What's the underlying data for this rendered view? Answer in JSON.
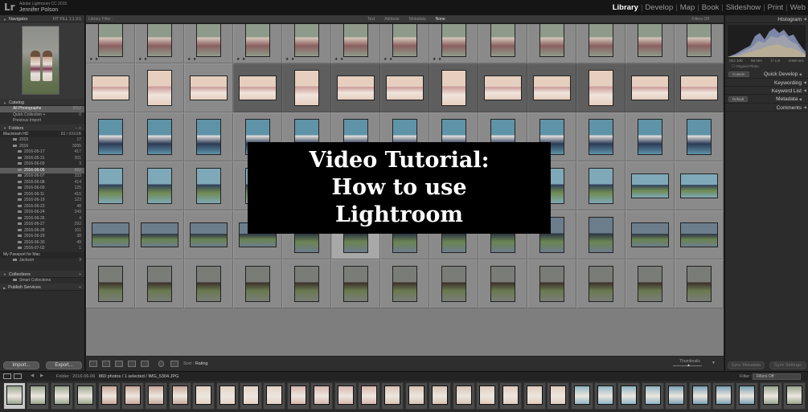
{
  "app": {
    "logo": "Lr",
    "name": "Adobe Lightroom CC 2015",
    "user": "Jennifer Polson"
  },
  "modules": [
    "Library",
    "Develop",
    "Map",
    "Book",
    "Slideshow",
    "Print",
    "Web"
  ],
  "active_module": "Library",
  "left_panel": {
    "navigator": {
      "title": "Navigator",
      "zoom_options": "FIT  FILL  1:1  3:1"
    },
    "catalog": {
      "title": "Catalog",
      "items": [
        {
          "label": "All Photographs",
          "count": "3112"
        },
        {
          "label": "Quick Collection +",
          "count": "0"
        },
        {
          "label": "Previous Import",
          "count": ""
        }
      ]
    },
    "folders": {
      "title": "Folders",
      "volume": {
        "label": "Macintosh HD",
        "count": "83 / 931GB"
      },
      "items": [
        {
          "label": "2015",
          "count": "17"
        },
        {
          "label": "2016",
          "count": "3095"
        },
        {
          "label": "2016-05-17",
          "count": "417"
        },
        {
          "label": "2016-05-31",
          "count": "201"
        },
        {
          "label": "2016-06-03",
          "count": "3"
        },
        {
          "label": "2016-06-06",
          "count": "860",
          "selected": true
        },
        {
          "label": "2016-06-07",
          "count": "333"
        },
        {
          "label": "2016-06-08",
          "count": "414"
        },
        {
          "label": "2016-06-09",
          "count": "125"
        },
        {
          "label": "2016-06-11",
          "count": "415"
        },
        {
          "label": "2016-06-19",
          "count": "123"
        },
        {
          "label": "2016-06-23",
          "count": "48"
        },
        {
          "label": "2016-06-24",
          "count": "249"
        },
        {
          "label": "2016-06-26",
          "count": "4"
        },
        {
          "label": "2016-06-27",
          "count": "292"
        },
        {
          "label": "2016-06-28",
          "count": "101"
        },
        {
          "label": "2016-06-29",
          "count": "38"
        },
        {
          "label": "2016-06-30",
          "count": "49"
        },
        {
          "label": "2016-07-02",
          "count": "1"
        }
      ],
      "volume2": {
        "label": "My Passport for Mac",
        "count": ""
      },
      "volume2_item": {
        "label": "Jackson",
        "count": "3"
      }
    },
    "collections": {
      "title": "Collections",
      "items": [
        {
          "label": "Smart Collections",
          "count": ""
        }
      ]
    },
    "publish": {
      "title": "Publish Services"
    },
    "import_label": "Import...",
    "export_label": "Export..."
  },
  "filter_bar": {
    "label": "Library Filter :",
    "options": [
      "Text",
      "Attribute",
      "Metadata",
      "None"
    ],
    "active": "None",
    "filters_off": "Filters Off"
  },
  "grid": {
    "rows": 6,
    "cols": 13,
    "star_text": "★ ★"
  },
  "overlay": {
    "line1": "Video Tutorial:",
    "line2": "How to use",
    "line3": "Lightroom"
  },
  "toolbar": {
    "sort_label": "Sort :",
    "sort_value": "Rating",
    "thumbnails_label": "Thumbnails"
  },
  "right_panel": {
    "histogram": {
      "title": "Histogram",
      "iso": "ISO 100",
      "focal": "50 mm",
      "aperture": "f / 1.8",
      "shutter": "1/400 sec",
      "original_photo": "Original Photo"
    },
    "quick_develop": {
      "preset": "Custom",
      "title": "Quick Develop"
    },
    "keywording": {
      "title": "Keywording"
    },
    "keyword_list": {
      "title": "Keyword List"
    },
    "metadata": {
      "preset": "Default",
      "title": "Metadata"
    },
    "comments": {
      "title": "Comments"
    },
    "sync_metadata": "Sync Metadata",
    "sync_settings": "Sync Settings"
  },
  "filmstrip_bar": {
    "folder_label": "Folder : 2016-06-06",
    "info": "860 photos / 1 selected / IMG_5304.JPG",
    "filter_label": "Filter :",
    "filter_value": "Filters Off"
  },
  "colors": {
    "active_module": "#ffffff",
    "panel_bg": "#2c2c2c",
    "grid_bg": "#7e7e7e",
    "overlay_bg": "#000000"
  }
}
